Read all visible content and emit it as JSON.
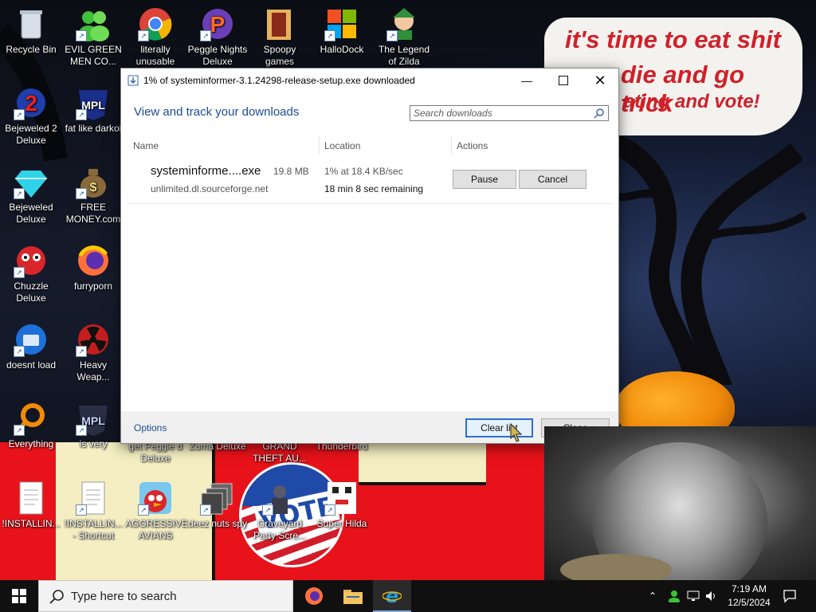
{
  "desktop": {
    "icons": [
      {
        "id": "recycle-bin",
        "label": "Recycle Bin"
      },
      {
        "id": "evil-green-men",
        "label": "EVIL GREEN MEN CO..."
      },
      {
        "id": "literally-unusable",
        "label": "literally unusable"
      },
      {
        "id": "peggle-nights",
        "label": "Peggle Nights Deluxe"
      },
      {
        "id": "spoopy-games",
        "label": "Spoopy games"
      },
      {
        "id": "hallodock",
        "label": "HalloDock"
      },
      {
        "id": "legend-of-zilda",
        "label": "The Legend of Zilda"
      },
      {
        "id": "bejeweled-2",
        "label": "Bejeweled 2 Deluxe"
      },
      {
        "id": "fat-like-darkoi",
        "label": "fat like darkoi"
      },
      {
        "id": "bejeweled",
        "label": "Bejeweled Deluxe"
      },
      {
        "id": "free-money",
        "label": "FREE MONEY.com"
      },
      {
        "id": "chuzzle",
        "label": "Chuzzle Deluxe"
      },
      {
        "id": "furryporn",
        "label": "furryporn"
      },
      {
        "id": "doesnt-load",
        "label": "doesnt load"
      },
      {
        "id": "heavy-weap",
        "label": "Heavy Weap..."
      },
      {
        "id": "everything",
        "label": "Everything"
      },
      {
        "id": "is-very",
        "label": "is very"
      },
      {
        "id": "get-peggle",
        "label": "get Peggle d Deluxe"
      },
      {
        "id": "zuma",
        "label": "Zuma Deluxe"
      },
      {
        "id": "gta",
        "label": "GRAND THEFT AU..."
      },
      {
        "id": "thunderbird",
        "label": "Thunderbird"
      },
      {
        "id": "installing",
        "label": "!INSTALLIN..."
      },
      {
        "id": "installing-shortcut",
        "label": "!INSTALLIN... - Shortcut"
      },
      {
        "id": "aggressive-avians",
        "label": "AGGRESSIVE AVIANS"
      },
      {
        "id": "deez-nuts",
        "label": "deez nuts spy"
      },
      {
        "id": "graveyard",
        "label": "Graveyard Party Scre..."
      },
      {
        "id": "super-hilda",
        "label": "Super Hilda"
      }
    ],
    "speech": {
      "line1": "it's time to eat shit",
      "line2": "die and go trick",
      "line3": "ating and vote!"
    },
    "badge_text": "VOTE"
  },
  "window": {
    "title": "1% of systeminformer-3.1.24298-release-setup.exe downloaded",
    "heading": "View and track your downloads",
    "search_placeholder": "Search downloads",
    "columns": {
      "name": "Name",
      "location": "Location",
      "actions": "Actions"
    },
    "download": {
      "filename": "systeminforme....exe",
      "size": "19.8 MB",
      "host": "unlimited.dl.sourceforge.net",
      "progress_speed": "1% at 18.4 KB/sec",
      "remaining": "18 min 8 sec remaining",
      "progress": 0.01
    },
    "buttons": {
      "pause": "Pause",
      "cancel": "Cancel",
      "clear": "Clear list",
      "close": "Close"
    },
    "options": "Options"
  },
  "taskbar": {
    "search_placeholder": "Type here to search",
    "time": "7:19 AM",
    "date": "12/5/2024"
  },
  "colors": {
    "accent": "#1b4d93",
    "speech_red": "#d0202a",
    "taskbar": "#101010"
  }
}
